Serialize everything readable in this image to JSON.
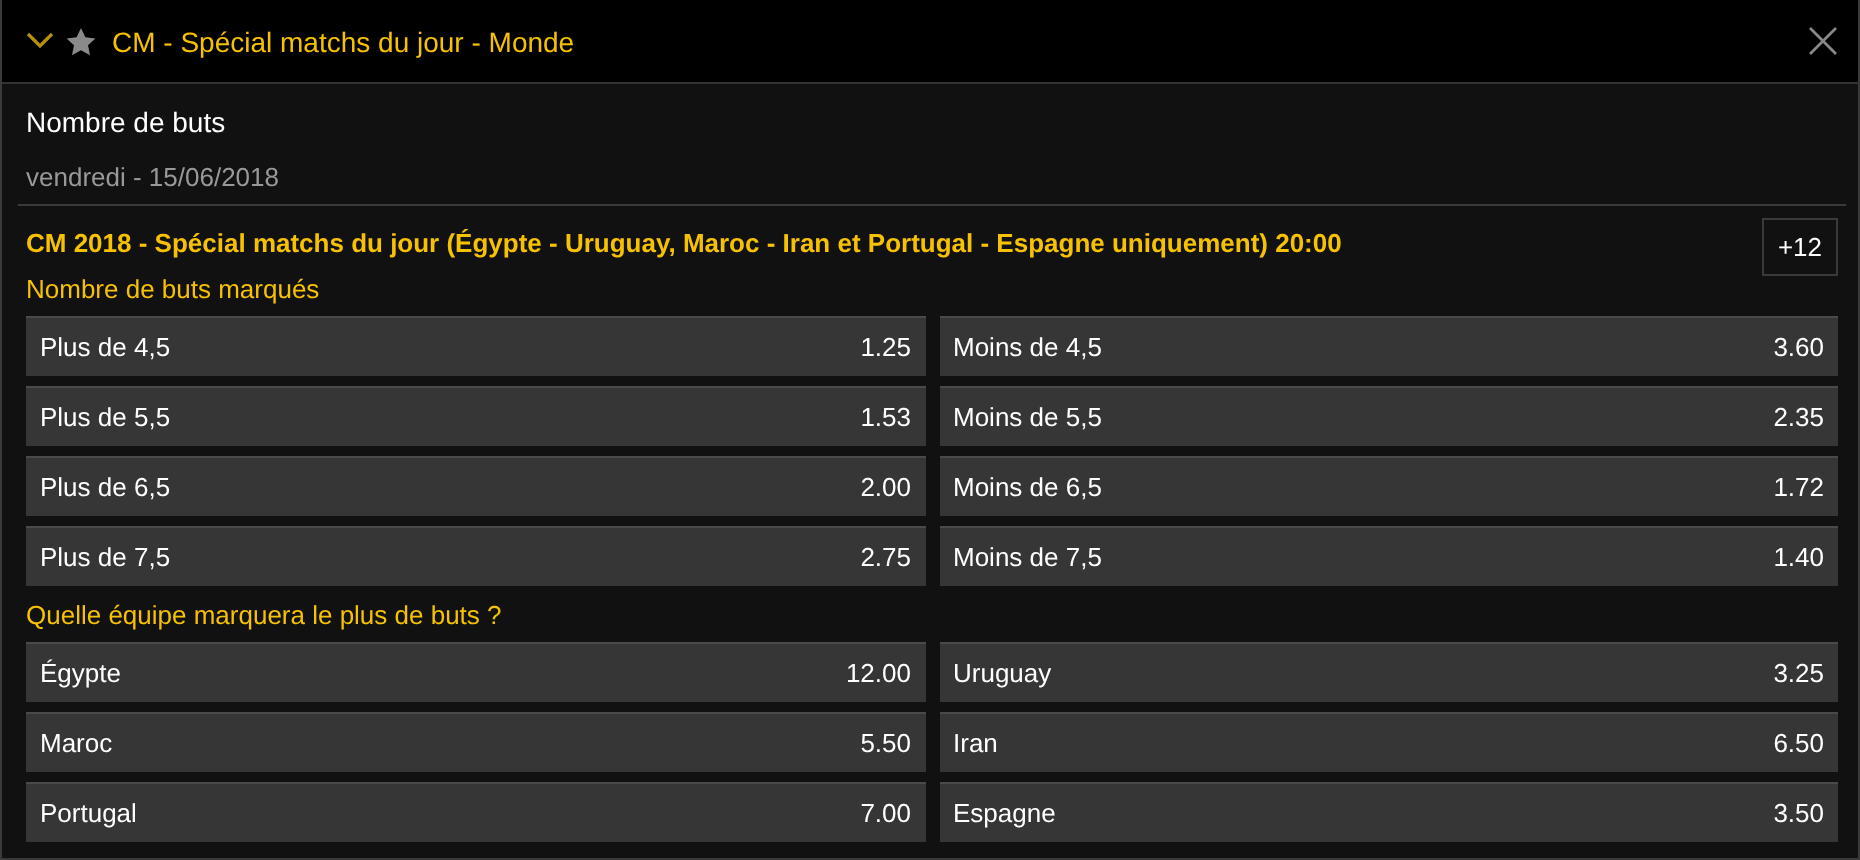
{
  "header": {
    "title": "CM - Spécial matchs du jour - Monde"
  },
  "market": {
    "title": "Nombre de buts",
    "date": "vendredi - 15/06/2018"
  },
  "event": {
    "title": "CM 2018 - Spécial matchs du jour (Égypte - Uruguay, Maroc - Iran et Portugal - Espagne uniquement) 20:00",
    "more": "+12"
  },
  "sections": [
    {
      "title": "Nombre de buts marqués",
      "rows": [
        [
          {
            "label": "Plus de 4,5",
            "odds": "1.25"
          },
          {
            "label": "Moins de 4,5",
            "odds": "3.60"
          }
        ],
        [
          {
            "label": "Plus de 5,5",
            "odds": "1.53"
          },
          {
            "label": "Moins de 5,5",
            "odds": "2.35"
          }
        ],
        [
          {
            "label": "Plus de 6,5",
            "odds": "2.00"
          },
          {
            "label": "Moins de 6,5",
            "odds": "1.72"
          }
        ],
        [
          {
            "label": "Plus de 7,5",
            "odds": "2.75"
          },
          {
            "label": "Moins de 7,5",
            "odds": "1.40"
          }
        ]
      ]
    },
    {
      "title": "Quelle équipe marquera le plus de buts ?",
      "rows": [
        [
          {
            "label": "Égypte",
            "odds": "12.00"
          },
          {
            "label": "Uruguay",
            "odds": "3.25"
          }
        ],
        [
          {
            "label": "Maroc",
            "odds": "5.50"
          },
          {
            "label": "Iran",
            "odds": "6.50"
          }
        ],
        [
          {
            "label": "Portugal",
            "odds": "7.00"
          },
          {
            "label": "Espagne",
            "odds": "3.50"
          }
        ]
      ]
    }
  ]
}
